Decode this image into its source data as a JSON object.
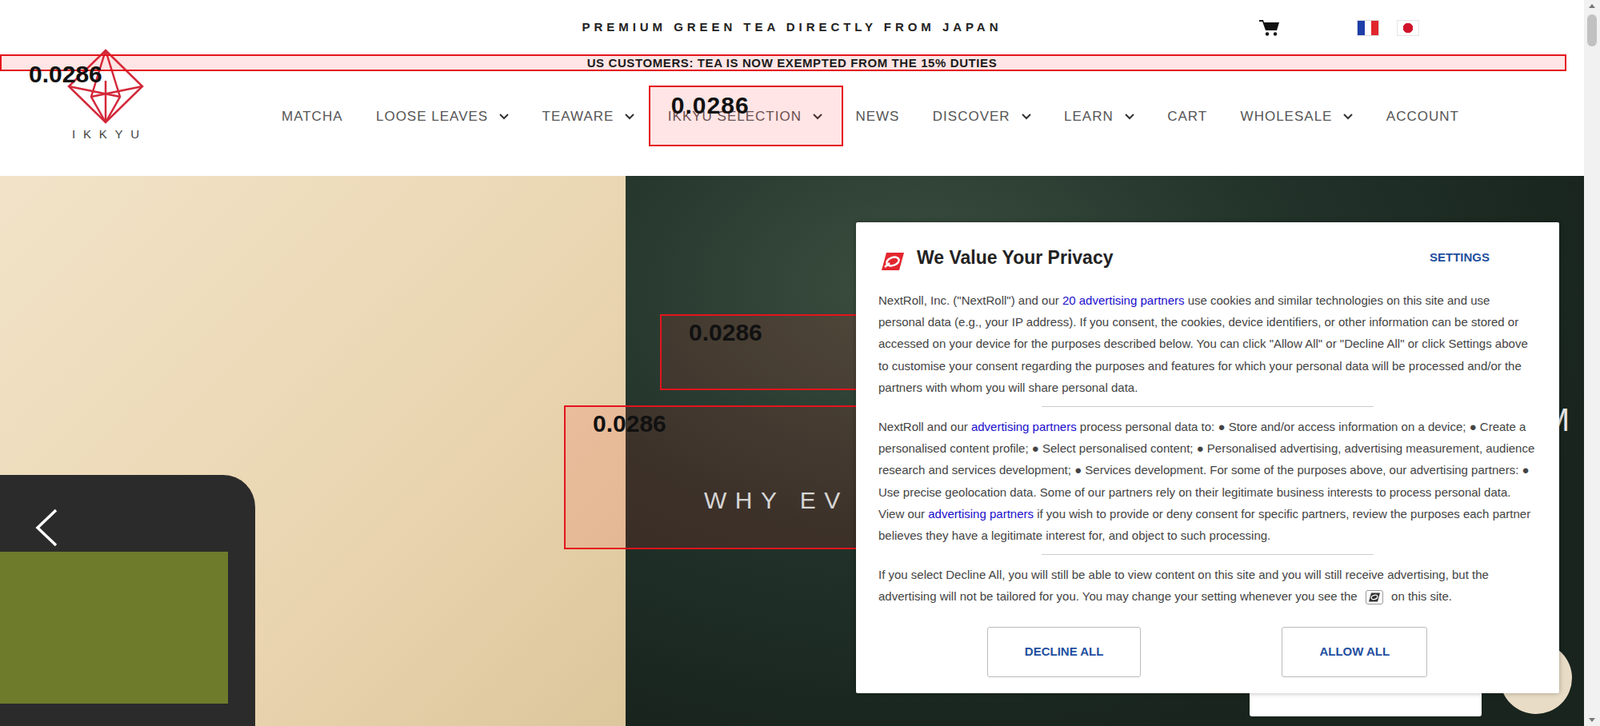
{
  "top_bar": {
    "tagline": "PREMIUM GREEN TEA DIRECTLY FROM JAPAN"
  },
  "announcement": {
    "text": "US CUSTOMERS: TEA IS NOW EXEMPTED FROM THE 15% DUTIES",
    "score": "0.0286"
  },
  "logo": {
    "text": "IKKYU"
  },
  "nav": [
    {
      "label": "MATCHA",
      "dropdown": false
    },
    {
      "label": "LOOSE LEAVES",
      "dropdown": true
    },
    {
      "label": "TEAWARE",
      "dropdown": true
    },
    {
      "label": "IKKYU SELECTION",
      "dropdown": true,
      "score": "0.0286"
    },
    {
      "label": "NEWS",
      "dropdown": false
    },
    {
      "label": "DISCOVER",
      "dropdown": true
    },
    {
      "label": "LEARN",
      "dropdown": true
    },
    {
      "label": "CART",
      "dropdown": false
    },
    {
      "label": "WHOLESALE",
      "dropdown": true
    },
    {
      "label": "ACCOUNT",
      "dropdown": false
    }
  ],
  "hero": {
    "heading": "WHY EV",
    "edge_text": "M",
    "score_boxes": [
      {
        "score": "0.0286"
      },
      {
        "score": "0.0286"
      }
    ]
  },
  "consent": {
    "title": "We Value Your Privacy",
    "settings": "SETTINGS",
    "paragraphs": [
      {
        "segments": [
          {
            "kind": "text",
            "text": "NextRoll, Inc. (\"NextRoll\") and our "
          },
          {
            "kind": "link",
            "text": "20 advertising partners"
          },
          {
            "kind": "text",
            "text": " use cookies and similar technologies on this site and use personal data (e.g., your IP address). If you consent, the cookies, device identifiers, or other information can be stored or accessed on your device for the purposes described below. You can click \"Allow All\" or \"Decline All\" or click Settings above to customise your consent regarding the purposes and features for which your personal data will be processed and/or the partners with whom you will share personal data."
          }
        ]
      },
      {
        "segments": [
          {
            "kind": "text",
            "text": "NextRoll and our "
          },
          {
            "kind": "link",
            "text": "advertising partners"
          },
          {
            "kind": "text",
            "text": " process personal data to: ● Store and/or access information on a device; ● Create a personalised content profile; ● Select personalised content; ● Personalised advertising, advertising measurement, audience research and services development; ● Services development. For some of the purposes above, our advertising partners: ● Use precise geolocation data. Some of our partners rely on their legitimate business interests to process personal data. View our "
          },
          {
            "kind": "link",
            "text": "advertising partners"
          },
          {
            "kind": "text",
            "text": " if you wish to provide or deny consent for specific partners, review the purposes each partner believes they have a legitimate interest for, and object to such processing."
          }
        ]
      },
      {
        "segments": [
          {
            "kind": "text",
            "text": "If you select Decline All, you will still be able to view content on this site and you will still receive advertising, but the advertising will not be tailored for you. You may change your setting whenever you see the "
          },
          {
            "kind": "icon"
          },
          {
            "kind": "text",
            "text": " on this site."
          }
        ]
      }
    ],
    "buttons": [
      "DECLINE ALL",
      "ALLOW ALL"
    ]
  }
}
